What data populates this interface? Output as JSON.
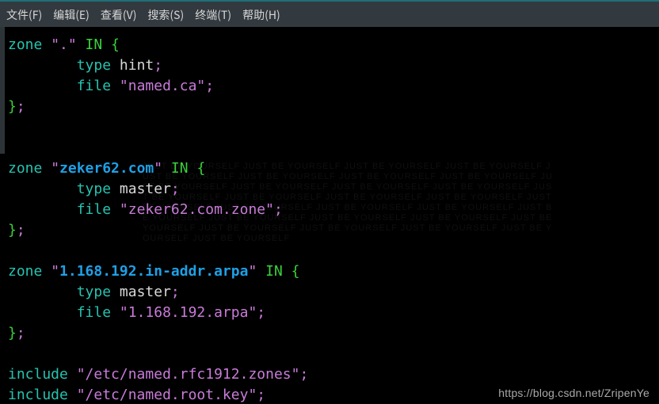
{
  "menu": {
    "file": "文件(F)",
    "edit": "编辑(E)",
    "view": "查看(V)",
    "search": "搜索(S)",
    "term": "终端(T)",
    "help": "帮助(H)"
  },
  "code": {
    "l1_zone": "zone ",
    "l1_q": "\".\"",
    "l1_in": " IN ",
    "l1_ob": "{",
    "indent": "        ",
    "l2_type": "type ",
    "l2_val": "hint",
    "semi": ";",
    "l3_file": "file ",
    "l3_val": "\"named.ca\"",
    "cb": "}",
    "z2_zone": "zone ",
    "z2_q1": "\"",
    "z2_name": "zeker62.com",
    "z2_q2": "\"",
    "z2_in": " IN ",
    "z2_ob": "{",
    "z2_type": "type ",
    "z2_tval": "master",
    "z2_file": "file ",
    "z2_fval": "\"zeker62.com.zone\"",
    "z3_zone": "zone ",
    "z3_q1": "\"",
    "z3_name": "1.168.192.in-addr.arpa",
    "z3_q2": "\"",
    "z3_in": " IN ",
    "z3_ob": "{",
    "z3_type": "type ",
    "z3_tval": "master",
    "z3_file": "file ",
    "z3_fval": "\"1.168.192.arpa\"",
    "inc": "include ",
    "inc1": "\"/etc/named.rfc1912.zones\"",
    "inc2": "\"/etc/named.root.key\""
  },
  "watermark": "https://blog.csdn.net/ZripenYe",
  "bg": "JUST BE YOURSELF JUST BE YOURSELF JUST BE YOURSELF JUST BE YOURSELF JUST BE YOURSELF JUST BE YOURSELF JUST BE YOURSELF JUST BE YOURSELF JUST BE YOURSELF JUST BE YOURSELF JUST BE YOURSELF JUST BE YOURSELF JUST BE YOURSELF JUST BE YOURSELF JUST BE YOURSELF JUST BE YOURSELF JUST BE YOURSELF JUST BE YOURSELF JUST BE YOURSELF JUST BE YOURSELF JUST BE YOURSELF JUST BE YOURSELF JUST BE YOURSELF JUST BE YOURSELF JUST BE YOURSELF JUST BE YOURSELF JUST BE YOURSELF JUST BE YOURSELF JUST BE YOURSELF JUST BE YOURSELF"
}
